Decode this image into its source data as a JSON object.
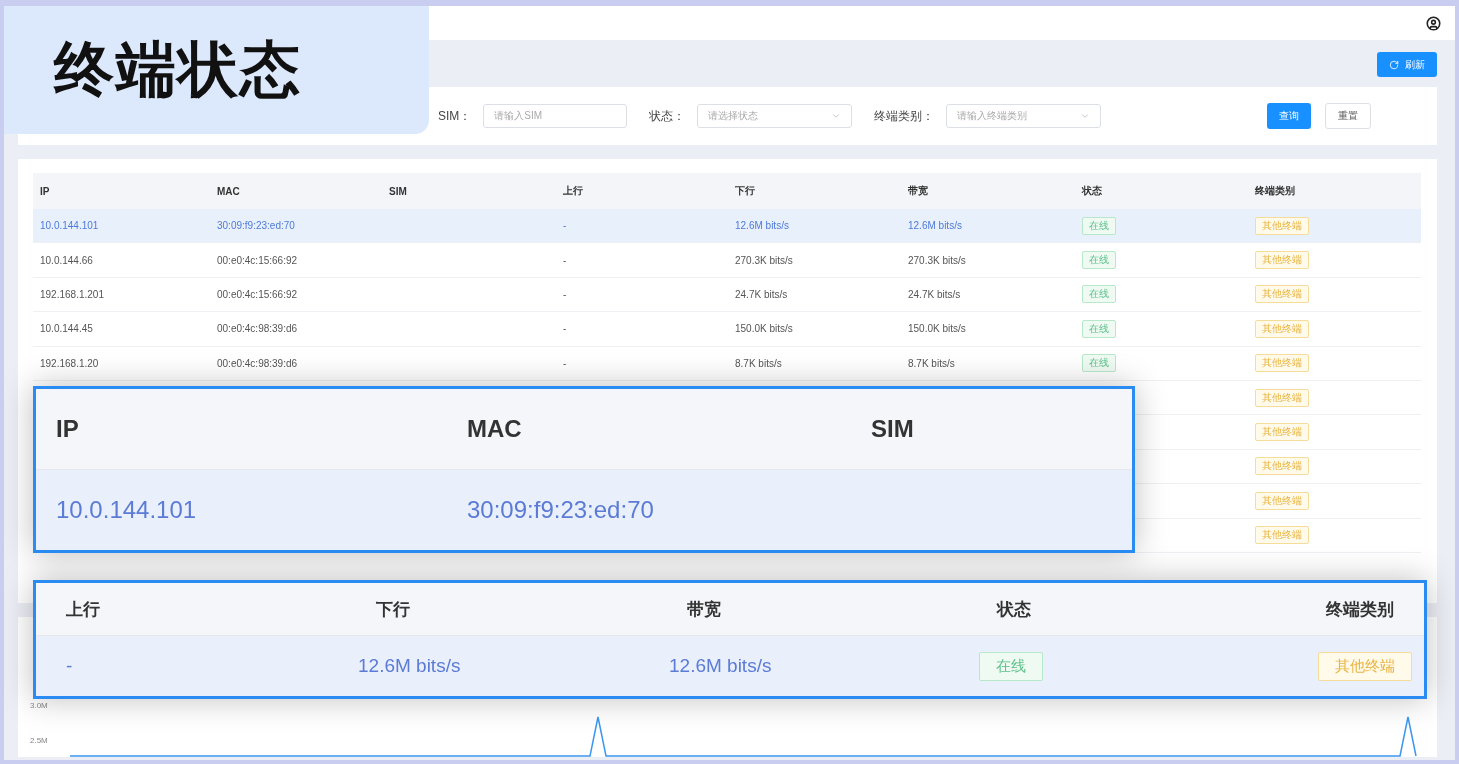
{
  "title": "终端状态",
  "refresh_button": "刷新",
  "filters": [
    {
      "label": "SIM：",
      "placeholder": "请输入SIM",
      "kind": "input"
    },
    {
      "label": "状态：",
      "placeholder": "请选择状态",
      "kind": "select"
    },
    {
      "label": "终端类别：",
      "placeholder": "请输入终端类别",
      "kind": "select"
    }
  ],
  "buttons": [
    {
      "label": "查询",
      "kind": "primary"
    },
    {
      "label": "重置",
      "kind": "default"
    }
  ],
  "table": {
    "columns": [
      "IP",
      "MAC",
      "SIM",
      "上行",
      "下行",
      "带宽",
      "状态",
      "终端类别"
    ],
    "rows": [
      {
        "ip": "10.0.144.101",
        "mac": "30:09:f9:23:ed:70",
        "up": "-",
        "down": "12.6M bits/s",
        "bandwidth": "12.6M bits/s",
        "status": "在线",
        "category": "其他终端",
        "selected": true
      },
      {
        "ip": "10.0.144.66",
        "mac": "00:e0:4c:15:66:92",
        "up": "-",
        "down": "270.3K bits/s",
        "bandwidth": "270.3K bits/s",
        "status": "在线",
        "category": "其他终端",
        "selected": false
      },
      {
        "ip": "192.168.1.201",
        "mac": "00:e0:4c:15:66:92",
        "up": "-",
        "down": "24.7K bits/s",
        "bandwidth": "24.7K bits/s",
        "status": "在线",
        "category": "其他终端",
        "selected": false
      },
      {
        "ip": "10.0.144.45",
        "mac": "00:e0:4c:98:39:d6",
        "up": "-",
        "down": "150.0K bits/s",
        "bandwidth": "150.0K bits/s",
        "status": "在线",
        "category": "其他终端",
        "selected": false
      },
      {
        "ip": "192.168.1.20",
        "mac": "00:e0:4c:98:39:d6",
        "up": "-",
        "down": "8.7K bits/s",
        "bandwidth": "8.7K bits/s",
        "status": "在线",
        "category": "其他终端",
        "selected": false
      },
      {
        "category": "其他终端",
        "selected": false
      },
      {
        "category": "其他终端",
        "selected": false
      },
      {
        "category": "其他终端",
        "selected": false
      },
      {
        "category": "其他终端",
        "selected": false
      },
      {
        "category": "其他终端",
        "selected": false
      }
    ]
  },
  "chart": {
    "y_labels": [
      "3.0M",
      "2.5M"
    ]
  },
  "callouts": [
    {
      "columns": [
        "IP",
        "MAC",
        "SIM"
      ],
      "cells": [
        {
          "text": "10.0.144.101",
          "kind": "text"
        },
        {
          "text": "30:09:f9:23:ed:70",
          "kind": "text"
        }
      ]
    },
    {
      "columns": [
        "上行",
        "下行",
        "带宽",
        "状态",
        "终端类别"
      ],
      "cells": [
        {
          "text": "-",
          "kind": "text"
        },
        {
          "text": "12.6M bits/s",
          "kind": "text"
        },
        {
          "text": "12.6M bits/s",
          "kind": "text"
        },
        {
          "text": "在线",
          "kind": "status"
        },
        {
          "text": "其他终端",
          "kind": "category"
        }
      ]
    }
  ]
}
